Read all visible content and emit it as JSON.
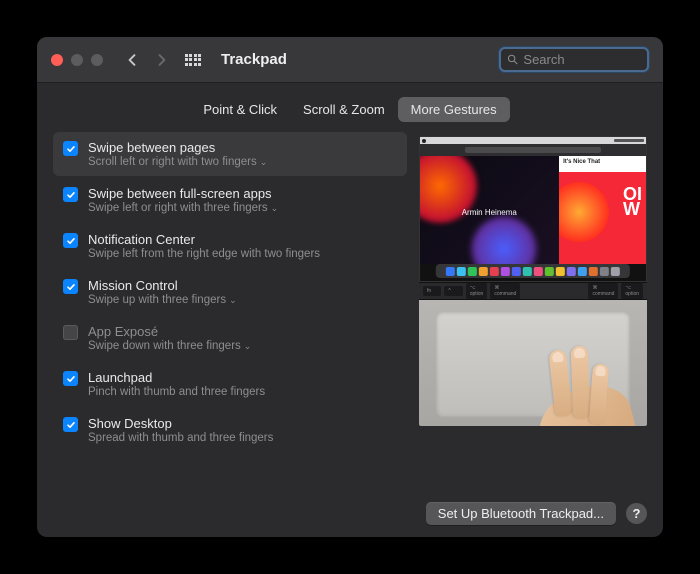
{
  "window": {
    "title": "Trackpad"
  },
  "search": {
    "placeholder": "Search"
  },
  "tabs": [
    {
      "label": "Point & Click",
      "active": false
    },
    {
      "label": "Scroll & Zoom",
      "active": false
    },
    {
      "label": "More Gestures",
      "active": true
    }
  ],
  "gestures": [
    {
      "title": "Swipe between pages",
      "sub": "Scroll left or right with two fingers",
      "checked": true,
      "dropdown": true,
      "selected": true
    },
    {
      "title": "Swipe between full-screen apps",
      "sub": "Swipe left or right with three fingers",
      "checked": true,
      "dropdown": true,
      "selected": false
    },
    {
      "title": "Notification Center",
      "sub": "Swipe left from the right edge with two fingers",
      "checked": true,
      "dropdown": false,
      "selected": false
    },
    {
      "title": "Mission Control",
      "sub": "Swipe up with three fingers",
      "checked": true,
      "dropdown": true,
      "selected": false
    },
    {
      "title": "App Exposé",
      "sub": "Swipe down with three fingers",
      "checked": false,
      "dropdown": true,
      "selected": false
    },
    {
      "title": "Launchpad",
      "sub": "Pinch with thumb and three fingers",
      "checked": true,
      "dropdown": false,
      "selected": false
    },
    {
      "title": "Show Desktop",
      "sub": "Spread with thumb and three fingers",
      "checked": true,
      "dropdown": false,
      "selected": false
    }
  ],
  "preview": {
    "artist": "Armin Heinema",
    "sidebar_label": "It's Nice That",
    "big_text": "OI\nW"
  },
  "footer": {
    "setup_label": "Set Up Bluetooth Trackpad...",
    "help_label": "?"
  },
  "dock_colors": [
    "#3478f6",
    "#3ac1f0",
    "#2fc45a",
    "#f0a030",
    "#e64050",
    "#b050e0",
    "#5060f0",
    "#30c0b0",
    "#f05080",
    "#60c030",
    "#f0c030",
    "#8070f0",
    "#40a0f0",
    "#e07030",
    "#808088",
    "#a0a0a8"
  ]
}
